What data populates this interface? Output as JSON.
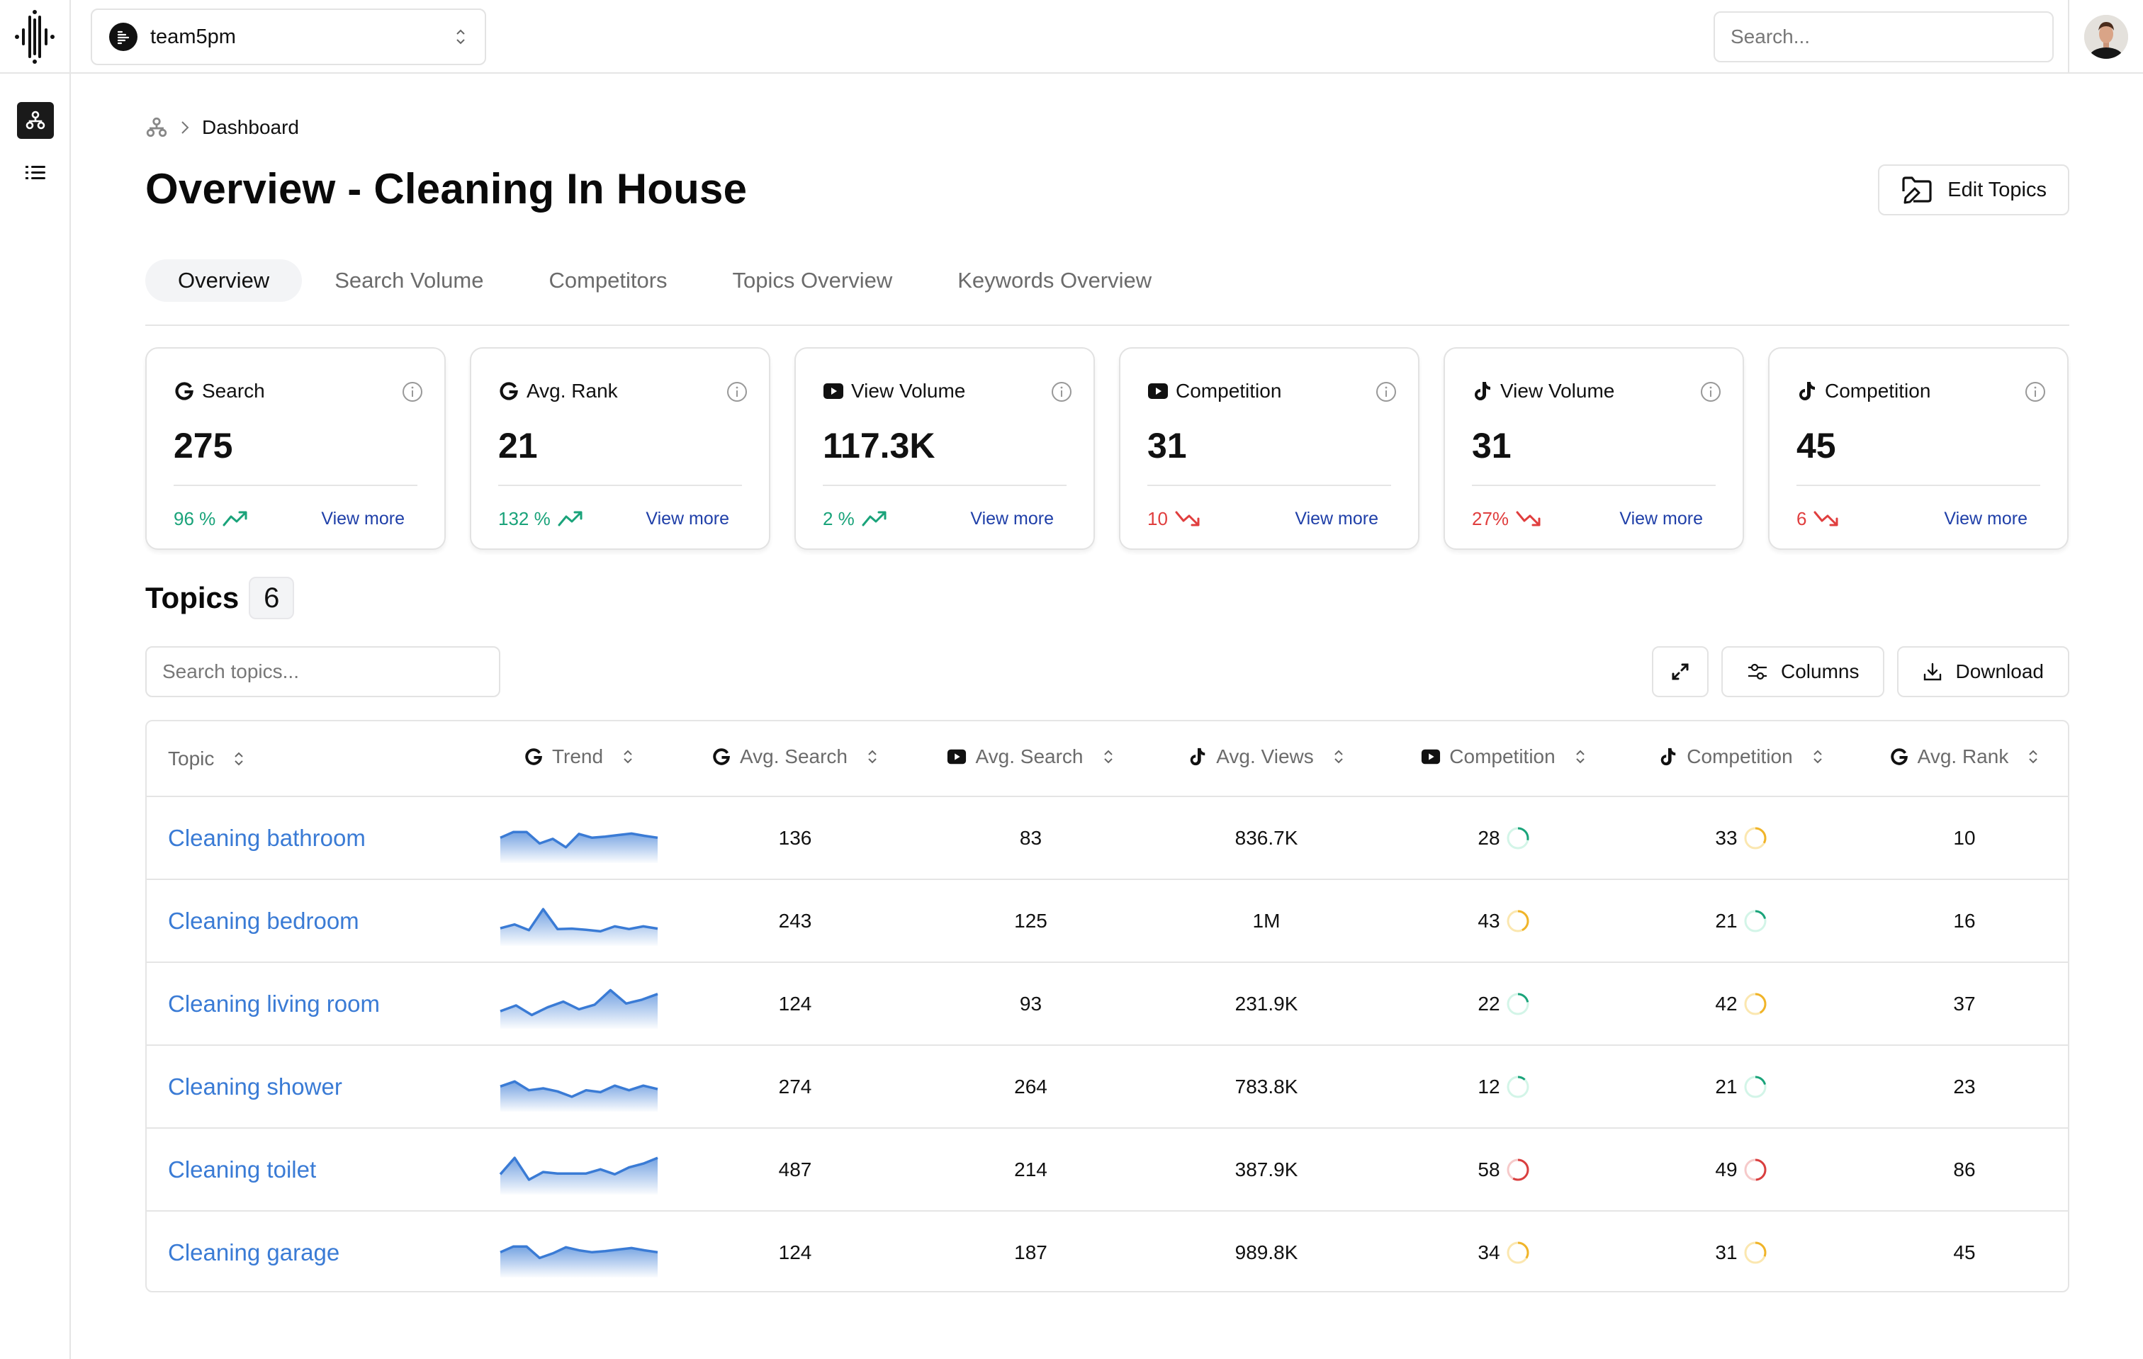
{
  "topbar": {
    "team_name": "team5pm",
    "search_placeholder": "Search..."
  },
  "breadcrumb": {
    "current": "Dashboard"
  },
  "page": {
    "title": "Overview - Cleaning In House",
    "edit_topics_label": "Edit Topics"
  },
  "tabs": [
    {
      "label": "Overview",
      "active": true
    },
    {
      "label": "Search Volume",
      "active": false
    },
    {
      "label": "Competitors",
      "active": false
    },
    {
      "label": "Topics Overview",
      "active": false
    },
    {
      "label": "Keywords Overview",
      "active": false
    }
  ],
  "cards": [
    {
      "platform": "google",
      "label": "Search",
      "value": "275",
      "delta": "96 %",
      "direction": "up",
      "link": "View more"
    },
    {
      "platform": "google",
      "label": "Avg. Rank",
      "value": "21",
      "delta": "132 %",
      "direction": "up",
      "link": "View more"
    },
    {
      "platform": "youtube",
      "label": "View Volume",
      "value": "117.3K",
      "delta": "2 %",
      "direction": "up",
      "link": "View more"
    },
    {
      "platform": "youtube",
      "label": "Competition",
      "value": "31",
      "delta": "10",
      "direction": "down",
      "link": "View more"
    },
    {
      "platform": "tiktok",
      "label": "View Volume",
      "value": "31",
      "delta": "27%",
      "direction": "down",
      "link": "View more"
    },
    {
      "platform": "tiktok",
      "label": "Competition",
      "value": "45",
      "delta": "6",
      "direction": "down",
      "link": "View more"
    }
  ],
  "topics": {
    "title": "Topics",
    "count": "6",
    "search_placeholder": "Search topics...",
    "columns_label": "Columns",
    "download_label": "Download"
  },
  "table": {
    "headers": [
      {
        "label": "Topic",
        "platform": ""
      },
      {
        "label": "Trend",
        "platform": "google"
      },
      {
        "label": "Avg. Search",
        "platform": "google"
      },
      {
        "label": "Avg. Search",
        "platform": "youtube"
      },
      {
        "label": "Avg. Views",
        "platform": "tiktok"
      },
      {
        "label": "Competition",
        "platform": "youtube"
      },
      {
        "label": "Competition",
        "platform": "tiktok"
      },
      {
        "label": "Avg. Rank",
        "platform": "google"
      }
    ],
    "rows": [
      {
        "topic": "Cleaning bathroom",
        "trend": [
          55,
          70,
          70,
          40,
          52,
          30,
          65,
          55,
          58,
          62,
          66,
          60,
          55
        ],
        "g_search": "136",
        "yt_search": "83",
        "tt_views": "836.7K",
        "yt_comp": 28,
        "tt_comp": 33,
        "g_rank": "10"
      },
      {
        "topic": "Cleaning bedroom",
        "trend": [
          35,
          45,
          30,
          85,
          33,
          34,
          31,
          27,
          40,
          33,
          40,
          34
        ],
        "g_search": "243",
        "yt_search": "125",
        "tt_views": "1M",
        "yt_comp": 43,
        "tt_comp": 21,
        "g_rank": "16"
      },
      {
        "topic": "Cleaning living room",
        "trend": [
          35,
          50,
          25,
          45,
          60,
          40,
          52,
          90,
          55,
          65,
          80
        ],
        "g_search": "124",
        "yt_search": "93",
        "tt_views": "231.9K",
        "yt_comp": 22,
        "tt_comp": 42,
        "g_rank": "37"
      },
      {
        "topic": "Cleaning shower",
        "trend": [
          55,
          68,
          45,
          50,
          42,
          28,
          45,
          40,
          57,
          45,
          57,
          48
        ],
        "g_search": "274",
        "yt_search": "264",
        "tt_views": "783.8K",
        "yt_comp": 12,
        "tt_comp": 21,
        "g_rank": "23"
      },
      {
        "topic": "Cleaning toilet",
        "trend": [
          42,
          85,
          28,
          48,
          44,
          44,
          44,
          55,
          42,
          60,
          70,
          85
        ],
        "g_search": "487",
        "yt_search": "214",
        "tt_views": "387.9K",
        "yt_comp": 58,
        "tt_comp": 49,
        "g_rank": "86"
      },
      {
        "topic": "Cleaning garage",
        "trend": [
          55,
          70,
          70,
          40,
          52,
          68,
          60,
          55,
          58,
          62,
          66,
          60,
          55
        ],
        "g_search": "124",
        "yt_search": "187",
        "tt_views": "989.8K",
        "yt_comp": 34,
        "tt_comp": 31,
        "g_rank": "45"
      }
    ]
  },
  "colors": {
    "accent_blue": "#3a7bd5",
    "link_blue": "#1f3fa8",
    "up_green": "#1aa37a",
    "down_red": "#e03e3e",
    "ring_green": "#1aa37a",
    "ring_yellow": "#f0b429",
    "ring_red": "#d93f3f"
  }
}
